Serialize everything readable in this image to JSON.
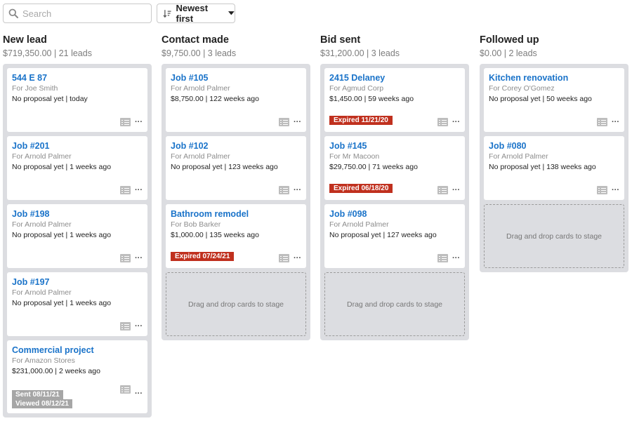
{
  "search": {
    "placeholder": "Search",
    "value": ""
  },
  "sort": {
    "label": "Newest first"
  },
  "columns": [
    {
      "title": "New lead",
      "summary": "$719,350.00 | 21 leads",
      "cards": [
        {
          "title": "544 E 87",
          "client": "For Joe Smith",
          "detail": "No proposal yet | today"
        },
        {
          "title": "Job #201",
          "client": "For Arnold Palmer",
          "detail": "No proposal yet | 1 weeks ago"
        },
        {
          "title": "Job #198",
          "client": "For Arnold Palmer",
          "detail": "No proposal yet | 1 weeks ago"
        },
        {
          "title": "Job #197",
          "client": "For Arnold Palmer",
          "detail": "No proposal yet | 1 weeks ago"
        },
        {
          "title": "Commercial project",
          "client": "For Amazon Stores",
          "detail": "$231,000.00 | 2 weeks ago",
          "sent": "Sent 08/11/21",
          "viewed": "Viewed 08/12/21"
        }
      ]
    },
    {
      "title": "Contact made",
      "summary": "$9,750.00 | 3 leads",
      "cards": [
        {
          "title": "Job #105",
          "client": "For Arnold Palmer",
          "detail": "$8,750.00 | 122 weeks ago"
        },
        {
          "title": "Job #102",
          "client": "For Arnold Palmer",
          "detail": "No proposal yet | 123 weeks ago"
        },
        {
          "title": "Bathroom remodel",
          "client": "For Bob Barker",
          "detail": "$1,000.00 | 135 weeks ago",
          "expired": "Expired 07/24/21"
        }
      ],
      "dropzone": "Drag and drop cards to stage"
    },
    {
      "title": "Bid sent",
      "summary": "$31,200.00 | 3 leads",
      "cards": [
        {
          "title": "2415 Delaney",
          "client": "For Agmud Corp",
          "detail": "$1,450.00 | 59 weeks ago",
          "expired": "Expired 11/21/20"
        },
        {
          "title": "Job #145",
          "client": "For Mr Macoon",
          "detail": "$29,750.00 | 71 weeks ago",
          "expired": "Expired 06/18/20"
        },
        {
          "title": "Job #098",
          "client": "For Arnold Palmer",
          "detail": "No proposal yet | 127 weeks ago"
        }
      ],
      "dropzone": "Drag and drop cards to stage"
    },
    {
      "title": "Followed up",
      "summary": "$0.00 | 2 leads",
      "cards": [
        {
          "title": "Kitchen renovation",
          "client": "For Corey O'Gomez",
          "detail": "No proposal yet | 50 weeks ago"
        },
        {
          "title": "Job #080",
          "client": "For Arnold Palmer",
          "detail": "No proposal yet | 138 weeks ago"
        }
      ],
      "dropzone": "Drag and drop cards to stage"
    }
  ],
  "icons": {
    "search": "search-icon",
    "sort": "sort-icon",
    "caret": "caret-down-icon",
    "document": "document-list-icon",
    "more": "more-options-icon"
  },
  "colors": {
    "link": "#1a73c9",
    "expired": "#c0301e",
    "sent_badge": "#a6a6a6",
    "lane": "#dcdde1"
  }
}
